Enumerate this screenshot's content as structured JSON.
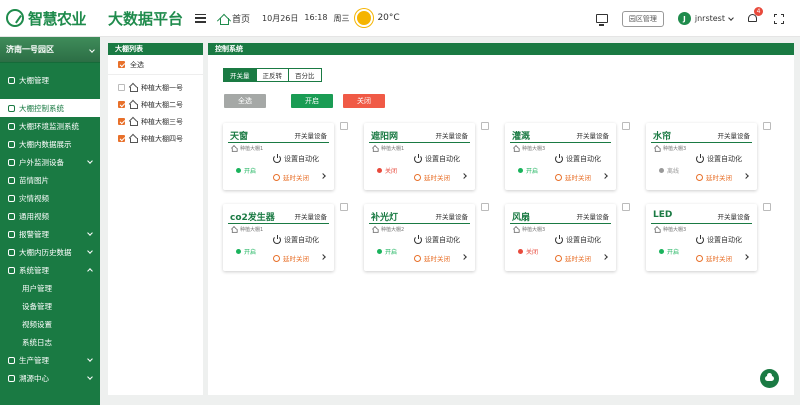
{
  "header": {
    "brand": "智慧农业",
    "platform": "大数据平台",
    "home_label": "首页",
    "date": "10月26日",
    "time": "16:18",
    "weekday": "周三",
    "temperature": "20°C",
    "park_manage": "园区管理",
    "avatar_letter": "J",
    "username": "jnrstest",
    "notification_count": "4"
  },
  "sidebar": {
    "park": "济南一号园区",
    "items": [
      {
        "label": "大棚管理",
        "icon": "greenhouse-icon"
      },
      {
        "label": "大棚控制系统",
        "icon": "control-icon",
        "active": true
      },
      {
        "label": "大棚环境监测系统",
        "icon": "monitor-icon"
      },
      {
        "label": "大棚内数据展示",
        "icon": "data-icon"
      },
      {
        "label": "户外监测设备",
        "icon": "outdoor-icon",
        "expandable": true
      },
      {
        "label": "苗情图片",
        "icon": "leaf-icon"
      },
      {
        "label": "灾情视频",
        "icon": "video-icon"
      },
      {
        "label": "通用视频",
        "icon": "camera-icon"
      },
      {
        "label": "报警管理",
        "icon": "alarm-icon",
        "expandable": true
      },
      {
        "label": "大棚内历史数据",
        "icon": "history-icon",
        "expandable": true
      },
      {
        "label": "系统管理",
        "icon": "gear-icon",
        "expanded": true
      },
      {
        "label": "用户管理",
        "sub": true
      },
      {
        "label": "设备管理",
        "sub": true
      },
      {
        "label": "视频设置",
        "sub": true
      },
      {
        "label": "系统日志",
        "sub": true
      },
      {
        "label": "生产管理",
        "icon": "production-icon",
        "expandable": true
      },
      {
        "label": "溯源中心",
        "icon": "trace-icon",
        "expandable": true
      }
    ]
  },
  "greenhouse_list": {
    "title": "大棚列表",
    "select_all": "全选",
    "items": [
      {
        "label": "种植大棚一号",
        "checked": false
      },
      {
        "label": "种植大棚二号",
        "checked": true
      },
      {
        "label": "种植大棚三号",
        "checked": true
      },
      {
        "label": "种植大棚四号",
        "checked": true
      }
    ]
  },
  "control": {
    "title": "控制系统",
    "tabs": [
      "开关量",
      "正反转",
      "百分比"
    ],
    "btn_all": "全选",
    "btn_open": "开启",
    "btn_close": "关闭",
    "auto_label": "设置自动化",
    "delay_label": "延时关闭",
    "devices": [
      {
        "name": "天窗",
        "type": "开关量设备",
        "location": "种植大棚1",
        "status": "开启",
        "status_color": "#1ab35c"
      },
      {
        "name": "遮阳网",
        "type": "开关量设备",
        "location": "种植大棚1",
        "status": "关闭",
        "status_color": "#e84a3c"
      },
      {
        "name": "灌溉",
        "type": "开关量设备",
        "location": "种植大棚3",
        "status": "开启",
        "status_color": "#1ab35c"
      },
      {
        "name": "水帘",
        "type": "开关量设备",
        "location": "种植大棚3",
        "status": "离线",
        "status_color": "#999999"
      },
      {
        "name": "co2发生器",
        "type": "开关量设备",
        "location": "种植大棚1",
        "status": "开启",
        "status_color": "#1ab35c"
      },
      {
        "name": "补光灯",
        "type": "开关量设备",
        "location": "种植大棚2",
        "status": "开启",
        "status_color": "#1ab35c"
      },
      {
        "name": "风扇",
        "type": "开关量设备",
        "location": "种植大棚3",
        "status": "关闭",
        "status_color": "#e84a3c"
      },
      {
        "name": "LED",
        "type": "开关量设备",
        "location": "种植大棚3",
        "status": "开启",
        "status_color": "#1ab35c"
      }
    ]
  },
  "colors": {
    "brand_green": "#1a7a43",
    "accent_orange": "#e8702a",
    "open_green": "#1a9c54",
    "close_red": "#f05a46"
  }
}
